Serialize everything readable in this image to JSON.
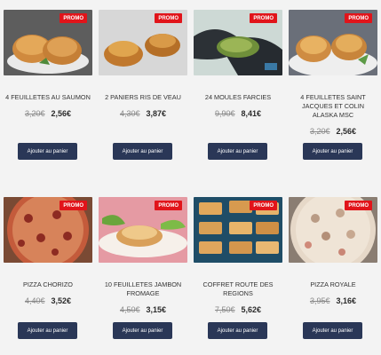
{
  "products": [
    {
      "name": "4 FEUILLETES AU SAUMON",
      "old_price": "3,20€",
      "new_price": "2,56€",
      "promo": "PROMO",
      "button": "Ajouter au panier",
      "image": "salmon-puff-pastries"
    },
    {
      "name": "2 PANIERS RIS DE VEAU",
      "old_price": "4,30€",
      "new_price": "3,87€",
      "promo": "PROMO",
      "button": "Ajouter au panier",
      "image": "veal-sweetbread-baskets"
    },
    {
      "name": "24 MOULES FARCIES",
      "old_price": "9,90€",
      "new_price": "8,41€",
      "promo": "PROMO",
      "button": "Ajouter au panier",
      "image": "stuffed-mussels"
    },
    {
      "name": "4 FEUILLETES SAINT JACQUES ET COLIN ALASKA MSC",
      "old_price": "3,20€",
      "new_price": "2,56€",
      "promo": "PROMO",
      "button": "Ajouter au panier",
      "image": "scallop-puff-pastries"
    },
    {
      "name": "PIZZA CHORIZO",
      "old_price": "4,40€",
      "new_price": "3,52€",
      "promo": "PROMO",
      "button": "Ajouter au panier",
      "image": "chorizo-pizza"
    },
    {
      "name": "10 FEUILLETES JAMBON FROMAGE",
      "old_price": "4,50€",
      "new_price": "3,15€",
      "promo": "PROMO",
      "button": "Ajouter au panier",
      "image": "ham-cheese-puffs"
    },
    {
      "name": "COFFRET ROUTE DES REGIONS",
      "old_price": "7,50€",
      "new_price": "5,62€",
      "promo": "PROMO",
      "button": "Ajouter au panier",
      "image": "appetizer-box"
    },
    {
      "name": "PIZZA ROYALE",
      "old_price": "3,95€",
      "new_price": "3,16€",
      "promo": "PROMO",
      "button": "Ajouter au panier",
      "image": "royale-pizza"
    }
  ]
}
